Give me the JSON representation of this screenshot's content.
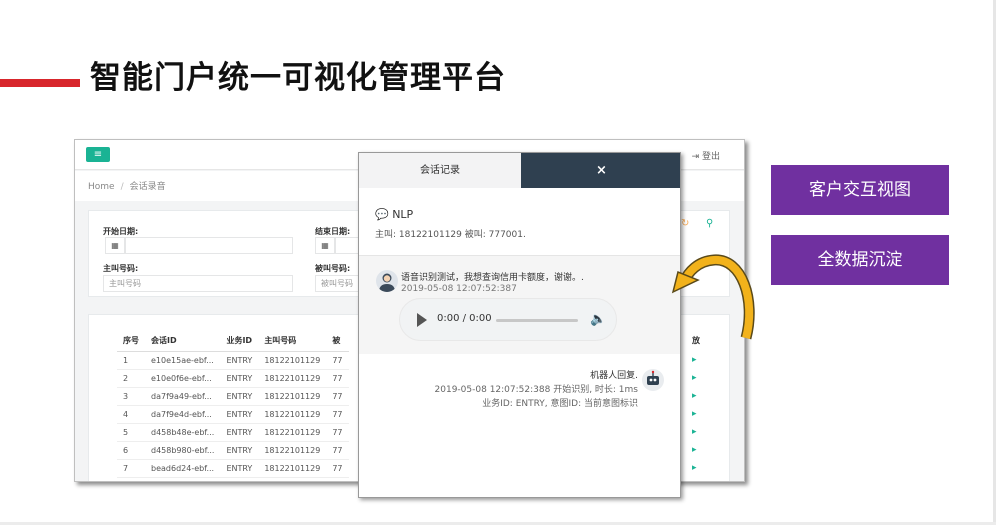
{
  "slide": {
    "title": "智能门户统一可视化管理平台"
  },
  "app": {
    "menu_icon": "≡",
    "logout_label": "登出",
    "breadcrumb": {
      "home": "Home",
      "separator": "/",
      "current": "会话录音"
    },
    "filters": {
      "start_date_label": "开始日期:",
      "end_date_label": "结束日期:",
      "caller_label": "主叫号码:",
      "called_label": "被叫号码:",
      "caller_placeholder": "主叫号码",
      "called_placeholder": "被叫号码"
    },
    "table": {
      "columns": [
        "序号",
        "会话ID",
        "业务ID",
        "主叫号码",
        "被"
      ],
      "last_column_header": "放",
      "rows": [
        [
          "1",
          "e10e15ae-ebf...",
          "ENTRY",
          "18122101129",
          "77"
        ],
        [
          "2",
          "e10e0f6e-ebf...",
          "ENTRY",
          "18122101129",
          "77"
        ],
        [
          "3",
          "da7f9a49-ebf...",
          "ENTRY",
          "18122101129",
          "77"
        ],
        [
          "4",
          "da7f9e4d-ebf...",
          "ENTRY",
          "18122101129",
          "77"
        ],
        [
          "5",
          "d458b48e-ebf...",
          "ENTRY",
          "18122101129",
          "77"
        ],
        [
          "6",
          "d458b980-ebf...",
          "ENTRY",
          "18122101129",
          "77"
        ],
        [
          "7",
          "bead6d24-ebf...",
          "ENTRY",
          "18122101129",
          "77"
        ]
      ]
    }
  },
  "modal": {
    "tab_label": "会话记录",
    "close_label": "×",
    "nlp_title": "NLP",
    "caller_info": "主叫: 18122101129 被叫: 777001.",
    "user_message": {
      "text": "语音识别测试，我想查询信用卡额度，谢谢。.",
      "time": "2019-05-08 12:07:52:387"
    },
    "audio": {
      "time": "0:00 / 0:00",
      "progress": 0
    },
    "bot_message": {
      "label": "机器人回复.",
      "time": "2019-05-08 12:07:52:388 开始识别, 时长: 1ms",
      "meta": "业务ID: ENTRY, 意图ID: 当前意图标识"
    }
  },
  "side_buttons": {
    "customer_view": "客户交互视图",
    "data_storage": "全数据沉淀"
  },
  "colors": {
    "accent_red": "#d8262c",
    "button_purple": "#7030a0",
    "modal_dark": "#2f4050",
    "menu_green": "#1ab394",
    "arrow_gold": "#f2b21b"
  }
}
